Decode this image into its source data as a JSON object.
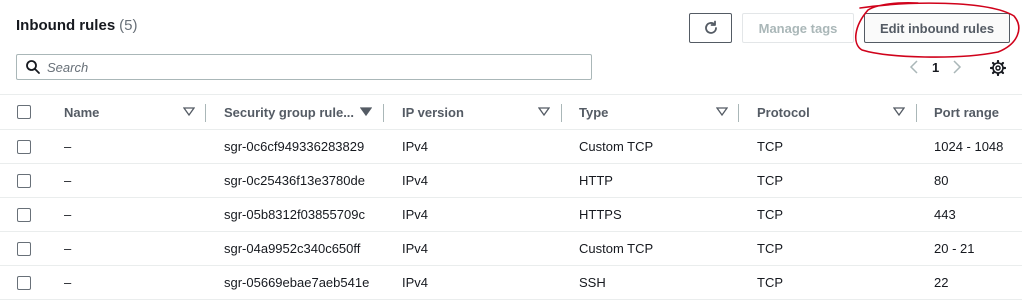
{
  "header": {
    "title": "Inbound rules",
    "count": "(5)",
    "manage_tags_label": "Manage tags",
    "edit_rules_label": "Edit inbound rules"
  },
  "search": {
    "placeholder": "Search"
  },
  "pagination": {
    "current_page": "1"
  },
  "columns": [
    "Name",
    "Security group rule...",
    "IP version",
    "Type",
    "Protocol",
    "Port range"
  ],
  "rows": [
    {
      "name": "–",
      "rule_id": "sgr-0c6cf949336283829",
      "ip_version": "IPv4",
      "type": "Custom TCP",
      "protocol": "TCP",
      "port_range": "1024 - 1048"
    },
    {
      "name": "–",
      "rule_id": "sgr-0c25436f13e3780de",
      "ip_version": "IPv4",
      "type": "HTTP",
      "protocol": "TCP",
      "port_range": "80"
    },
    {
      "name": "–",
      "rule_id": "sgr-05b8312f03855709c",
      "ip_version": "IPv4",
      "type": "HTTPS",
      "protocol": "TCP",
      "port_range": "443"
    },
    {
      "name": "–",
      "rule_id": "sgr-04a9952c340c650ff",
      "ip_version": "IPv4",
      "type": "Custom TCP",
      "protocol": "TCP",
      "port_range": "20 - 21"
    },
    {
      "name": "–",
      "rule_id": "sgr-05669ebae7aeb541e",
      "ip_version": "IPv4",
      "type": "SSH",
      "protocol": "TCP",
      "port_range": "22"
    }
  ],
  "colors": {
    "annotation": "#d0021b",
    "border": "#eaeded",
    "text": "#16191f",
    "muted": "#545b64",
    "disabled": "#aab7b8"
  },
  "icons": [
    "refresh-icon",
    "search-icon",
    "chevron-left-icon",
    "chevron-right-icon",
    "gear-icon",
    "sort-icon"
  ]
}
